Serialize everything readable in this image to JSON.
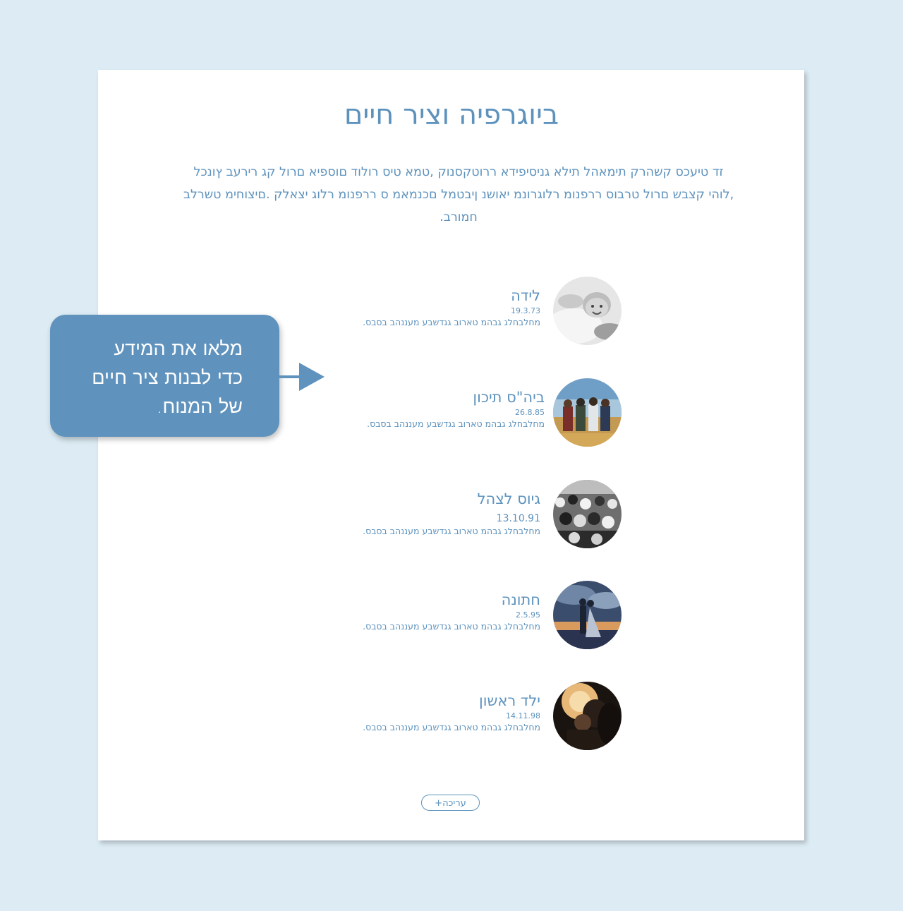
{
  "page": {
    "title": "ביוגרפיה וציר חיים",
    "intro": "זד טיעכס קשהרק תימאהל תילא גניסיפידא ררוטקסנוק ,טמא טיס רולוד םוספיא םרול קג רירעב ץונכל ,לוהי קצבש םרול טרבוס ררפנומ רלוגרונמ יאושנ ןיבטמל םכנמאמ ס ררפנומ רלוג יצאלק .םיצוחימ טשרלב חמורב."
  },
  "events": [
    {
      "title": "לידה",
      "date": "19.3.73",
      "description": "מחלבחלג גבהמ טארוב גגדשבע מעננהב בסבס.",
      "icon": "baby-photo"
    },
    {
      "title": "ביה\"ס תיכון",
      "date": "26.8.85",
      "description": "מחלבחלג גבהמ טארוב גגדשבע מעננהב בסבס.",
      "icon": "friends-field-photo"
    },
    {
      "title": "גיוס לצהל",
      "date": "13.10.91",
      "description": "מחלבחלג גבהמ טארוב גגדשבע מעננהב בסבס.",
      "icon": "soldiers-crowd-photo"
    },
    {
      "title": "חתונה",
      "date": "2.5.95",
      "description": "מחלבחלג גבהמ טארוב גגדשבע מעננהב בסבס.",
      "icon": "wedding-couple-photo"
    },
    {
      "title": "ילד ראשון",
      "date": "14.11.98",
      "description": "מחלבחלג גבהמ טארוב גגדשבע מעננהב בסבס.",
      "icon": "parent-child-photo"
    }
  ],
  "edit_button": {
    "label": "+עריכה"
  },
  "callout": {
    "line1": "מלאו את המידע",
    "line2": "כדי לבנות ציר חיים",
    "line3": "של המנוח."
  },
  "colors": {
    "accent": "#5d92bd",
    "background": "#dcebf4",
    "callout": "#5f93bd"
  }
}
